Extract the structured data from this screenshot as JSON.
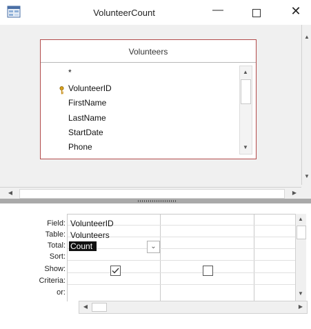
{
  "window": {
    "title": "VolunteerCount",
    "minimize_glyph": "—",
    "close_glyph": "✕",
    "app_icon": "query-icon"
  },
  "table_box": {
    "title": "Volunteers",
    "fields": [
      "*",
      "VolunteerID",
      "FirstName",
      "LastName",
      "StartDate",
      "Phone"
    ],
    "key_field_icon": "primary-key-icon"
  },
  "query_grid": {
    "row_labels": {
      "field": "Field:",
      "table": "Table:",
      "total": "Total:",
      "sort": "Sort:",
      "show": "Show:",
      "criteria": "Criteria:",
      "or": "or:"
    },
    "columns": [
      {
        "field": "VolunteerID",
        "table": "Volunteers",
        "total": "Count",
        "show": true
      },
      {
        "field": "",
        "table": "",
        "total": "",
        "show": false
      }
    ]
  },
  "colors": {
    "table_border": "#b24a4a",
    "pane_background": "#f0f0f0",
    "splitter": "#a9a9a9",
    "selection": "#111111"
  }
}
